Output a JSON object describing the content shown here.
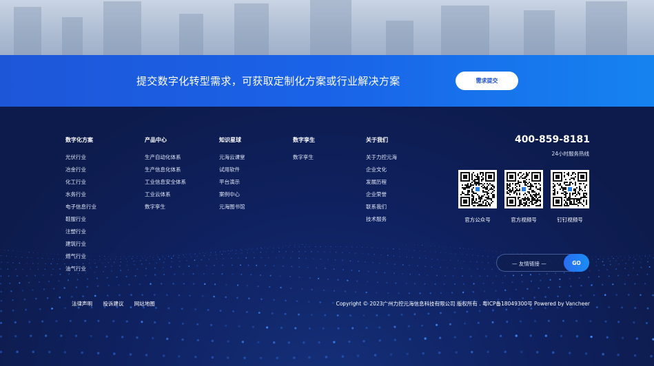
{
  "cta": {
    "text": "提交数字化转型需求，可获取定制化方案或行业解决方案",
    "button": "需求提交"
  },
  "columns": [
    {
      "title": "数字化方案",
      "items": [
        "光伏行业",
        "冶金行业",
        "化工行业",
        "水务行业",
        "电子信息行业",
        "鞋服行业",
        "注塑行业",
        "建筑行业",
        "燃气行业",
        "油气行业"
      ]
    },
    {
      "title": "产品中心",
      "items": [
        "生产自动化体系",
        "生产信息化体系",
        "工业信息安全体系",
        "工业云体系",
        "数字孪生"
      ]
    },
    {
      "title": "知识星球",
      "items": [
        "元海云课堂",
        "试用软件",
        "平台演示",
        "案例中心",
        "元海图书馆"
      ]
    },
    {
      "title": "数字孪生",
      "items": [
        "数字孪生"
      ]
    },
    {
      "title": "关于我们",
      "items": [
        "关于力控元海",
        "企业文化",
        "发展历程",
        "企业荣誉",
        "联系我们",
        "技术服务"
      ]
    }
  ],
  "contact": {
    "phone": "400-859-8181",
    "hotline": "24小时服务热线"
  },
  "qrcodes": [
    {
      "label": "官方公众号"
    },
    {
      "label": "官方视频号"
    },
    {
      "label": "钉钉视频号"
    }
  ],
  "friend_links": {
    "label": "— 友情链接 —",
    "go": "GO"
  },
  "bottom_links": [
    "法律声明",
    "投诉建议",
    "网站地图"
  ],
  "copyright": "Copyright © 2023广州力控元海信息科技有限公司 版权所有 . 粤ICP备18049300号  Powered by Vancheer",
  "colors": {
    "cta_blue": "#1a63e8",
    "footer_bg": "#0d1b4c",
    "accent": "#1b8df5"
  }
}
